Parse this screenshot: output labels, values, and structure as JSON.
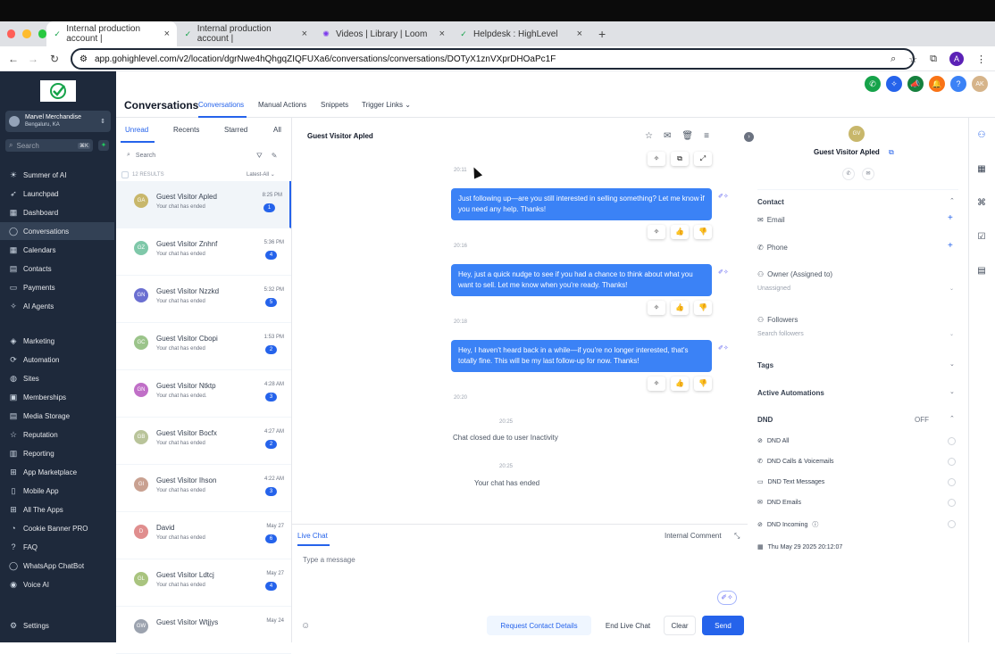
{
  "browser": {
    "tabs": [
      {
        "label": "Internal production account |",
        "active": true
      },
      {
        "label": "Internal production account |",
        "active": false
      },
      {
        "label": "Videos | Library | Loom",
        "active": false
      },
      {
        "label": "Helpdesk : HighLevel",
        "active": false
      }
    ],
    "new_tab": "+",
    "url": "app.gohighlevel.com/v2/location/dgrNwe4hQhgqZIQFUXa6/conversations/conversations/DOTyX1znVXprDHOaPc1F",
    "profile_initial": "A"
  },
  "sidebar": {
    "account_name": "Marvel Merchandise",
    "account_location": "Bengaluru, KA",
    "search_placeholder": "Search",
    "search_shortcut": "⌘K",
    "items": [
      {
        "label": "Summer of AI",
        "icon": "sun-icon"
      },
      {
        "label": "Launchpad",
        "icon": "rocket-icon"
      },
      {
        "label": "Dashboard",
        "icon": "dashboard-icon"
      },
      {
        "label": "Conversations",
        "icon": "chat-icon",
        "active": true
      },
      {
        "label": "Calendars",
        "icon": "calendar-icon"
      },
      {
        "label": "Contacts",
        "icon": "contacts-icon"
      },
      {
        "label": "Payments",
        "icon": "payments-icon"
      },
      {
        "label": "AI Agents",
        "icon": "ai-agent-icon"
      },
      {
        "label": "Marketing",
        "icon": "marketing-icon"
      },
      {
        "label": "Automation",
        "icon": "automation-icon"
      },
      {
        "label": "Sites",
        "icon": "globe-icon"
      },
      {
        "label": "Memberships",
        "icon": "membership-icon"
      },
      {
        "label": "Media Storage",
        "icon": "media-icon"
      },
      {
        "label": "Reputation",
        "icon": "star-icon"
      },
      {
        "label": "Reporting",
        "icon": "chart-icon"
      },
      {
        "label": "App Marketplace",
        "icon": "grid-icon"
      },
      {
        "label": "Mobile App",
        "icon": "phone-icon"
      },
      {
        "label": "All The Apps",
        "icon": "apps-icon"
      },
      {
        "label": "Cookie Banner PRO",
        "icon": "cookie-icon"
      },
      {
        "label": "FAQ",
        "icon": "question-icon"
      },
      {
        "label": "WhatsApp ChatBot",
        "icon": "whatsapp-icon"
      },
      {
        "label": "Voice AI",
        "icon": "voice-icon"
      }
    ],
    "settings_label": "Settings"
  },
  "header": {
    "title": "Conversations",
    "tabs": [
      "Conversations",
      "Manual Actions",
      "Snippets",
      "Trigger Links"
    ],
    "user_initials": "AK"
  },
  "list": {
    "filters": [
      "Unread",
      "Recents",
      "Starred",
      "All"
    ],
    "search_placeholder": "Search",
    "results": "12 RESULTS",
    "sort": "Latest-All",
    "conversations": [
      {
        "initials": "GA",
        "name": "Guest Visitor Apled",
        "sub": "Your chat has ended",
        "time": "8:25 PM",
        "count": "1",
        "color": "#c8b76b"
      },
      {
        "initials": "GZ",
        "name": "Guest Visitor Znhnf",
        "sub": "Your chat has ended",
        "time": "5:36 PM",
        "count": "4",
        "color": "#7fc8a9"
      },
      {
        "initials": "GN",
        "name": "Guest Visitor Nzzkd",
        "sub": "Your chat has ended",
        "time": "5:32 PM",
        "count": "5",
        "color": "#6b6fd1"
      },
      {
        "initials": "GC",
        "name": "Guest Visitor Cbopi",
        "sub": "Your chat has ended",
        "time": "1:53 PM",
        "count": "2",
        "color": "#9bc48a"
      },
      {
        "initials": "GN",
        "name": "Guest Visitor Ntktp",
        "sub": "Your chat has ended.",
        "time": "4:28 AM",
        "count": "3",
        "color": "#c06fc7"
      },
      {
        "initials": "GB",
        "name": "Guest Visitor Bocfx",
        "sub": "Your chat has ended",
        "time": "4:27 AM",
        "count": "2",
        "color": "#b9c49a"
      },
      {
        "initials": "GI",
        "name": "Guest Visitor Ihson",
        "sub": "Your chat has ended",
        "time": "4:22 AM",
        "count": "3",
        "color": "#c9a191"
      },
      {
        "initials": "D",
        "name": "David",
        "sub": "Your chat has ended",
        "time": "May 27",
        "count": "6",
        "color": "#e08e8e"
      },
      {
        "initials": "GL",
        "name": "Guest Visitor Ldtcj",
        "sub": "Your chat has ended",
        "time": "May 27",
        "count": "4",
        "color": "#a9c47f"
      },
      {
        "initials": "GW",
        "name": "Guest Visitor Wtjjys",
        "sub": "",
        "time": "May 24",
        "count": "",
        "color": "#9ca3af"
      }
    ]
  },
  "chat": {
    "title": "Guest Visitor Apled",
    "messages": [
      {
        "ts": "20:11",
        "text": "Just following up—are you still interested in selling something? Let me know if you need any help. Thanks!"
      },
      {
        "ts": "20:16",
        "text": "Hey, just a quick nudge to see if you had a chance to think about what you want to sell. Let me know when you're ready. Thanks!"
      },
      {
        "ts": "20:18",
        "text": "Hey, I haven't heard back in a while—if you're no longer interested, that's totally fine. This will be my last follow-up for now. Thanks!"
      }
    ],
    "ts_extra": "20:20",
    "system1_ts": "20:25",
    "system1": "Chat closed due to user Inactivity",
    "system2_ts": "20:25",
    "system2": "Your chat has ended",
    "composer": {
      "tab_live": "Live Chat",
      "tab_internal": "Internal Comment",
      "placeholder": "Type a message",
      "btn_request": "Request Contact Details",
      "btn_end": "End Live Chat",
      "btn_clear": "Clear",
      "btn_send": "Send"
    }
  },
  "contact": {
    "initials": "GV",
    "name": "Guest Visitor Apled",
    "section_contact": "Contact",
    "email_label": "Email",
    "phone_label": "Phone",
    "owner_label": "Owner (Assigned to)",
    "owner_value": "Unassigned",
    "followers_label": "Followers",
    "followers_placeholder": "Search followers",
    "tags": "Tags",
    "automations": "Active Automations",
    "dnd": "DND",
    "dnd_state": "OFF",
    "dnd_items": [
      "DND All",
      "DND Calls & Voicemails",
      "DND Text Messages",
      "DND Emails",
      "DND Incoming"
    ],
    "timestamp": "Thu May 29 2025 20:12:07"
  },
  "colors": {
    "accent": "#2563eb",
    "sidebar_bg": "#1e293b",
    "bubble": "#3b82f6"
  }
}
